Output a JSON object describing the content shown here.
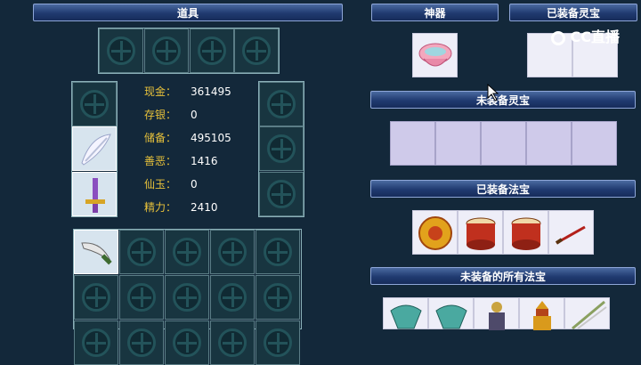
{
  "headers": {
    "items": "道具",
    "artifact": "神器",
    "equipped_lingbao": "已装备灵宝",
    "unequipped_lingbao": "未装备灵宝",
    "equipped_fabao": "已装备法宝",
    "all_unequipped_fabao": "未装备的所有法宝"
  },
  "stats": [
    {
      "label": "现金：",
      "value": "361495"
    },
    {
      "label": "存银：",
      "value": "0"
    },
    {
      "label": "储备：",
      "value": "495105"
    },
    {
      "label": "善恶：",
      "value": "1416"
    },
    {
      "label": "仙玉：",
      "value": "0"
    },
    {
      "label": "精力：",
      "value": "2410"
    }
  ],
  "watermark": "CC直播",
  "icons": {
    "artifact": "pink-bowl-icon",
    "equipped_fabao": [
      "golden-disc-icon",
      "red-drum-icon",
      "red-drum-icon",
      "red-sword-icon"
    ],
    "unequipped_fabao": [
      "teal-bowl-icon",
      "teal-bowl-icon",
      "armored-figure-icon",
      "golden-pagoda-icon",
      "feather-blade-icon"
    ],
    "inventory": [
      "white-feather-icon",
      "golden-dagger-icon",
      "curved-blade-icon"
    ]
  }
}
